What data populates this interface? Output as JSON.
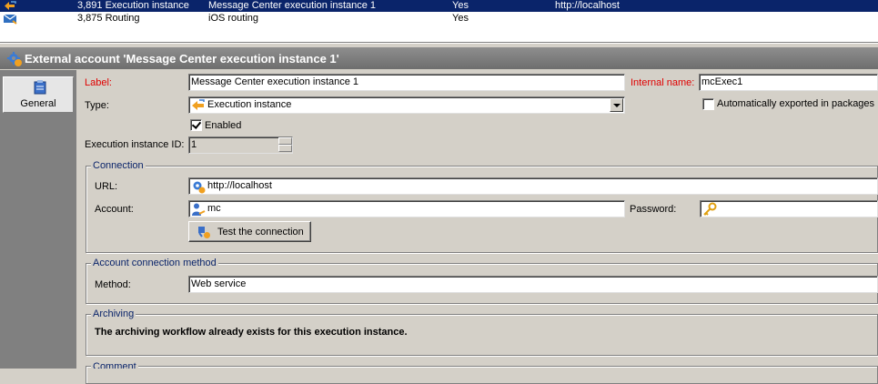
{
  "list": {
    "rows": [
      {
        "id": "3,891 Execution instance",
        "label": "Message Center execution instance 1",
        "internal": "Yes",
        "url": "http://localhost",
        "selected": true
      },
      {
        "id": "3,875 Routing",
        "label": "iOS routing",
        "internal": "Yes",
        "url": "",
        "selected": false
      }
    ]
  },
  "title": "External account 'Message Center execution instance 1'",
  "sidebar": {
    "tabs": [
      {
        "label": "General"
      }
    ]
  },
  "form": {
    "label_label": "Label:",
    "label_value": "Message Center execution instance 1",
    "internal_name_label": "Internal name:",
    "internal_name_value": "mcExec1",
    "type_label": "Type:",
    "type_value": "Execution instance",
    "auto_export_label": "Automatically exported in packages",
    "auto_export_checked": false,
    "enabled_label": "Enabled",
    "enabled_checked": true,
    "exec_id_label": "Execution instance ID:",
    "exec_id_value": "1"
  },
  "connection": {
    "legend": "Connection",
    "url_label": "URL:",
    "url_value": "http://localhost",
    "account_label": "Account:",
    "account_value": "mc",
    "password_label": "Password:",
    "password_value": "",
    "test_button": "Test the connection"
  },
  "account_method": {
    "legend": "Account connection method",
    "method_label": "Method:",
    "method_value": "Web service"
  },
  "archiving": {
    "legend": "Archiving",
    "message": "The archiving workflow already exists for this execution instance."
  },
  "comment": {
    "legend": "Comment"
  },
  "colors": {
    "selection": "#0a246a",
    "required_label": "#e00000",
    "group_legend": "#0a246a",
    "title_bar": "#7a7a7a"
  }
}
